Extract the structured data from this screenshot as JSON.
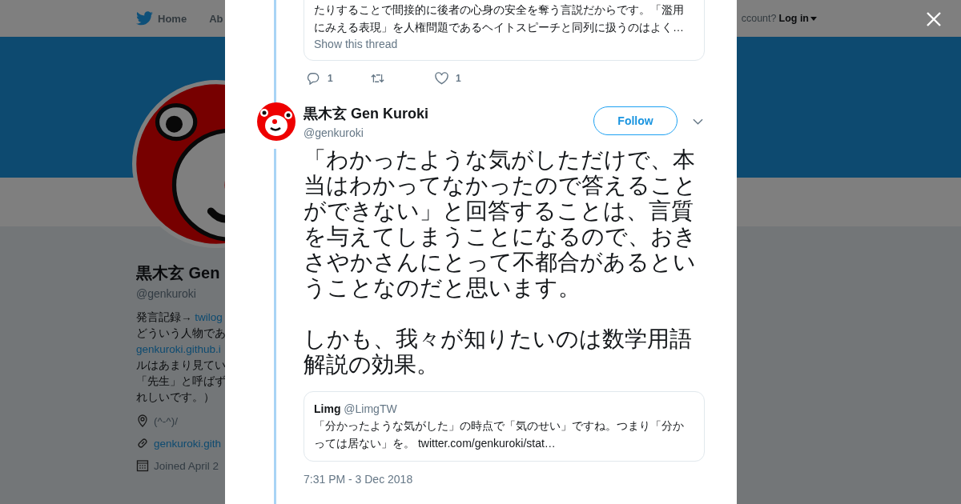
{
  "background_page": {
    "nav_items": [
      {
        "label": "Home",
        "kind": "home"
      },
      {
        "label": "Ab",
        "kind": "plain"
      }
    ],
    "login_prompt": "ccount?",
    "login_link": "Log in",
    "profile": {
      "name": "黒木玄 Gen",
      "handle": "@genkuroki",
      "bio_lines": [
        [
          {
            "text": "発言記録→ ",
            "kind": "plain"
          },
          {
            "text": "twilog",
            "kind": "link"
          }
        ],
        [
          {
            "text": "どういう人物であ",
            "kind": "plain"
          }
        ],
        [
          {
            "text": "genkuroki.github.i",
            "kind": "link"
          }
        ],
        [
          {
            "text": "ルはあまり見てい",
            "kind": "plain"
          }
        ],
        [
          {
            "text": "「先生」と呼ばず",
            "kind": "plain"
          }
        ],
        [
          {
            "text": "れしいです。）",
            "kind": "plain"
          }
        ]
      ],
      "meta": [
        {
          "kind": "location",
          "text": "(^-^)/"
        },
        {
          "kind": "url",
          "text": "genkuroki.gith"
        },
        {
          "kind": "joined",
          "text": "Joined April 2"
        }
      ]
    }
  },
  "modal": {
    "previous_tweet": {
      "quote_text": "たりすることで間接的に後者の心身の安全を奪う言説だからです。「濫用にみえる表現」を人権問題であるヘイトスピーチと同列に扱うのはよく…",
      "show_thread": "Show this thread",
      "reply_count": "1",
      "like_count": "1"
    },
    "tweet": {
      "name": "黒木玄 Gen Kuroki",
      "handle": "@genkuroki",
      "follow_label": "Follow",
      "paragraphs": [
        "「わかったような気がしただけで、本当はわかってなかったので答えることができない」と回答することは、言質を与えてしまうことになるので、おきさやかさんにとって不都合があるということなのだと思います。",
        "しかも、我々が知りたいのは数学用語解説の効果。"
      ],
      "quoted": {
        "name": "Limg",
        "handle": "@LimgTW",
        "text": "「分かったような気がした」の時点で「気のせい」ですね。つまり「分かっては居ない」を。 twitter.com/genkuroki/stat…"
      },
      "timestamp": "7:31 PM - 3 Dec 2018"
    }
  }
}
